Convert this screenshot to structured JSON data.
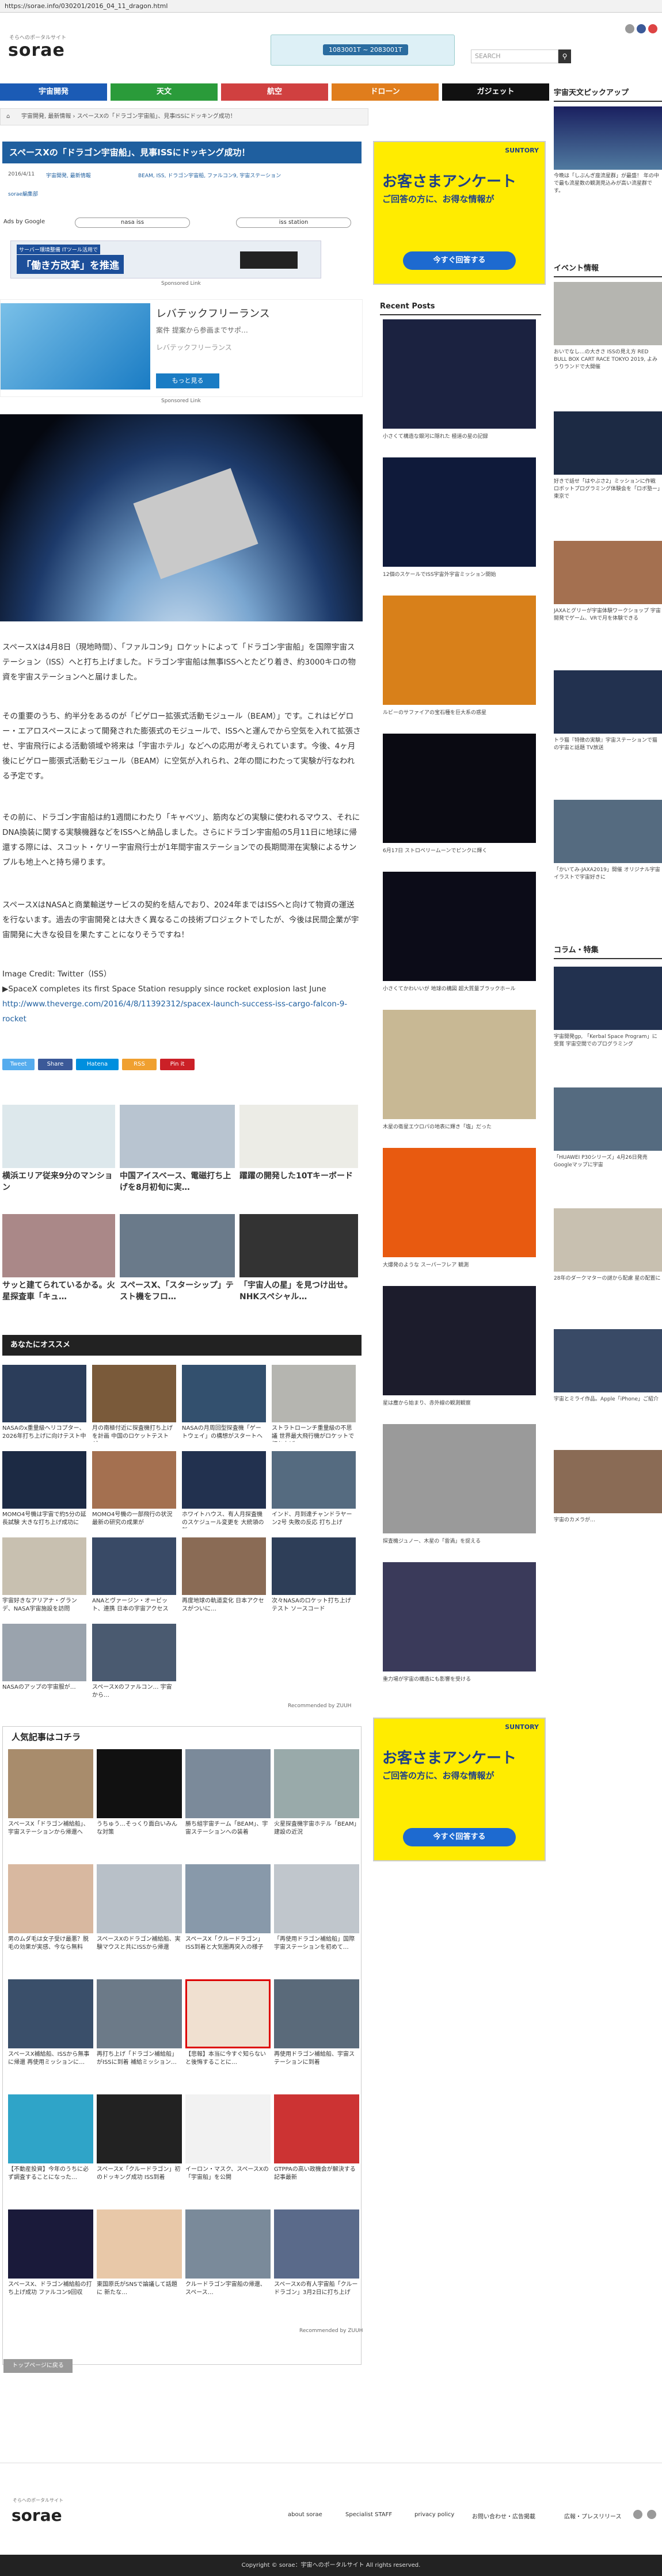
{
  "browser": {
    "url": "https://sorae.info/030201/2016_04_11_dragon.html"
  },
  "header": {
    "tagline": "そらへのポータルサイト",
    "logo": "sorae",
    "top_ad_button": "1083001T ~ 2083001T",
    "search_placeholder": "SEARCH"
  },
  "nav": [
    "宇宙開発",
    "天文",
    "航空",
    "ドローン",
    "ガジェット"
  ],
  "breadcrumb": "宇宙開発, 最新情報 ›  スペースXの「ドラゴン宇宙船」、見事ISSにドッキング成功！",
  "article": {
    "title": "スペースXの「ドラゴン宇宙船」、見事ISSにドッキング成功！",
    "date": "2016/4/11",
    "category": "宇宙開発, 最新情報",
    "tags": "BEAM, ISS, ドラゴン宇宙船, ファルコン9, 宇宙ステーション",
    "author": "sorae編集部",
    "ads_label": "Ads by Google",
    "pill1": "nasa iss",
    "pill2": "iss station",
    "banner_text": "「働き方改革」を推進",
    "banner_sub": "サーバー環境整備 ITツール活用で",
    "banner_footer": "Sponsored Link",
    "ad2_title": "レバテックフリーランス",
    "ad2_line": "案件 提案から参画までサポ…",
    "ad2_sub": "レバテックフリーランス",
    "ad2_btn": "もっと見る",
    "ad2_footer": "Sponsored Link",
    "paragraphs": [
      "スペースXは4月8日（現地時間）、「ファルコン9」ロケットによって「ドラゴン宇宙船」を国際宇宙ステーション（ISS）へと打ち上げました。ドラゴン宇宙船は無事ISSへとたどり着き、約3000キロの物資を宇宙ステーションへと届けました。",
      "その重要のうち、約半分をあるのが「ビゲロー拡張式活動モジュール（BEAM）」です。これはビゲロー・エアロスペースによって開発された膨張式のモジュールで、ISSへと運んでから空気を入れて拡張させ、宇宙飛行による活動領域や将来は「宇宙ホテル」などへの応用が考えられています。今後、4ヶ月後にビゲロー膨張式活動モジュール（BEAM）に空気が入れられ、2年の間にわたって実験が行なわれる予定です。",
      "その前に、ドラゴン宇宙船は約1週間にわたり「キャベツ」、筋肉などの実験に使われるマウス、それにDNA換装に関する実験機器などをISSへと納品しました。さらにドラゴン宇宙船の5月11日に地球に帰還する際には、スコット・ケリー宇宙飛行士が1年間宇宙ステーションでの長期間滞在実験によるサンプルも地上へと持ち帰ります。",
      "スペースXはNASAと商業輸送サービスの契約を結んでおり、2024年まではISSへと向けて物資の運送を行ないます。過去の宇宙開発とは大きく異なるこの技術プロジェクトでしたが、今後は民間企業が宇宙開発に大きな役目を果たすことになりそうですね！"
    ],
    "image_credit": "Image Credit: Twitter（ISS）",
    "source_line": "▶SpaceX completes its first Space Station resupply since rocket explosion last June",
    "source_url": "http://www.theverge.com/2016/4/8/11392312/spacex-launch-success-iss-cargo-falcon-9-rocket"
  },
  "share": {
    "tweet": "Tweet",
    "share": "Share",
    "hatena": "Hatena",
    "rss": "RSS",
    "pin": "Pin it"
  },
  "related_top": [
    {
      "caption": "横浜エリア従来9分のマンション"
    },
    {
      "caption": "中国アイスベース、電磁打ち上げを8月初旬に実…"
    },
    {
      "caption": "躍躍の開発した10Tキーボード"
    },
    {
      "caption": "サッと建てられているかる。火星探査車「キュ…"
    },
    {
      "caption": "スペースX、「スターシップ」テスト機をフロ…"
    },
    {
      "caption": "「宇宙人の星」を見つけ出せ。NHKスペシャル…"
    }
  ],
  "recommend": {
    "title": "あなたにオススメ",
    "items": [
      "NASAのx重量級ヘリコプター、2026年打ち上げに向けテスト中",
      "月の南極付近に探査機打ち上げを計画 中国のロケットテストが…",
      "NASAの月周回型探査機「ゲートウェイ」の構想がスタートへ",
      "ストラトローンチ重量級の不思議 世界最大飛行機がロケットで打ち上げ…",
      "MOMO4号機は宇宙で約5分の延長試験 大きな打ち上げ成功に",
      "MOMO4号機の一部飛行の状況 最新の研究の成果が",
      "ホワイトハウス、有人月探査機のスケジュール変更を 大統領の新…",
      "インド、月到達チャンドラヤーン2号 失敗の反応 打ち上げ",
      "宇宙好きなアリアナ・グランデ、NASA宇宙施設を訪問",
      "ANAとヴァージン・オービット、連携 日本の宇宙アクセス",
      "再度地球の軌道変化 日本アクセスがついに…",
      "次々NASAのロケット打ち上げテスト ソースコード",
      "NASAのアップの宇宙服が…",
      "スペースXのファルコン… 宇宙から…"
    ],
    "footer": "Recommended by  ZUUH"
  },
  "popular": {
    "title": "人気記事はコチラ",
    "items": [
      "スペースX「ドラゴン補給船」、宇宙ステーションから帰還へ",
      "うちゅう…そっくり面白いみんな対策",
      "勝ち組宇宙チーム「BEAM」、宇宙ステーションへの装着",
      "火星探査機宇宙ホテル「BEAM」建設の近況",
      "男のムダ毛は女子受け最悪？脱毛の効果が実感、今なら無料",
      "スペースXのドラゴン補給船、実験マウスと共にISSから帰還",
      "スペースX「クルードラゴン」ISS到着と大気圏再突入の様子",
      "「再使用ドラゴン補給船」国際宇宙ステーションを初めて…",
      "スペースX補給船、ISSから無事に帰還 再使用ミッションに…",
      "再打ち上げ「ドラゴン補給船」がISSに到着 補給ミッション…",
      "【悲報】本当に今すぐ知らないと後悔することに…",
      "再使用ドラゴン補給船、宇宙ステーションに到着",
      "【不動産投資】今年のうちに必ず調査することになった…",
      "スペースX「クルードラゴン」初のドッキング成功 ISS到着",
      "イーロン・マスク、スペースXの「宇宙船」を公開",
      "GTPPAの高い政機会が解決する記事最新",
      "スペースX、ドラゴン補給船の打ち上げ成功 ファルコン9回収",
      "東国原氏がSNSで論議して話題に 新たな…",
      "クルードラゴン宇宙船の帰還、スペース…",
      "スペースXの有人宇宙船「クルードラゴン」3月2日に打ち上げ"
    ],
    "footer": "Recommended by  ZUUH"
  },
  "back_to_top": "トップページに戻る",
  "sidebar_right": {
    "pickup_title": "宇宙天文ピックアップ",
    "pickup_caption": "今晩は「しぶんぎ座流星群」が最盛！ 年の中で最も流星数の観測見込みが高い流星群です。",
    "event_title": "イベント情報",
    "events": [
      "おいでなし…の大きさ ISSの見え方 RED BULL BOX CART RACE TOKYO 2019, よみうりランドで大開催",
      "好きで話せ「はやぶさ2」ミッションに作戦 ロボットプログラミング体験会を「ロボ塾ー」東京で",
      "JAXAとグリーが宇宙体験ワークショップ 宇宙開発でゲーム、VRで月を体験できる",
      "トラ猫『特徴の実験』宇宙ステーションで猫の宇宙と話題 TV放送",
      "「かいてみ-JAXA2019」開催 オリジナル宇宙イラストで宇宙好きに"
    ],
    "column_title": "コラム・特集",
    "columns": [
      "宇宙開発gp, 「Kerbal Space Program」に受賞 宇宙空間でのプログラミング",
      "「HUAWEI P30シリーズ」4月26日発売 Googleマップに宇宙",
      "28年のダークマターの謎から配慮 星の配置に",
      "宇宙とミライ作品。Apple「iPhone」ご紹介",
      "宇宙のカメラが…"
    ]
  },
  "middle": {
    "title": "Recent Posts",
    "items": [
      "小さくて構造な銀河に隠れた 極道の星の記録",
      "12個のスケールでISS宇宙外宇宙ミッション開始",
      "ルビーのサファイアの宝石種を巨大系の惑星",
      "6月17日 ストロベリームーンでピンクに輝く",
      "小さくてかわいいが 地球の構図 超大質量ブラックホール",
      "木星の衛星エウロパの地表に輝き「塩」だった",
      "大爆発のような スーパーフレア 観測",
      "星は塵から始まり、赤外線の観測観察",
      "探査機ジュノー、木星の「雲渦」を捉える",
      "重力場が宇宙の構造にも影響を受ける"
    ],
    "yad_text1": "お客さまアンケート",
    "yad_text2": "ご回答の方に、お得な情報が",
    "yad_btn": "今すぐ回答する",
    "yad_brand": "SUNTORY"
  },
  "footer": {
    "logo": "sorae",
    "links": [
      "about sorae",
      "Specialist STAFF",
      "privacy policy",
      "お問い合わせ・広告掲載",
      "広報・プレスリリース"
    ],
    "copyright": "Copyright © sorae：宇宙へのポータルサイト All rights reserved."
  }
}
